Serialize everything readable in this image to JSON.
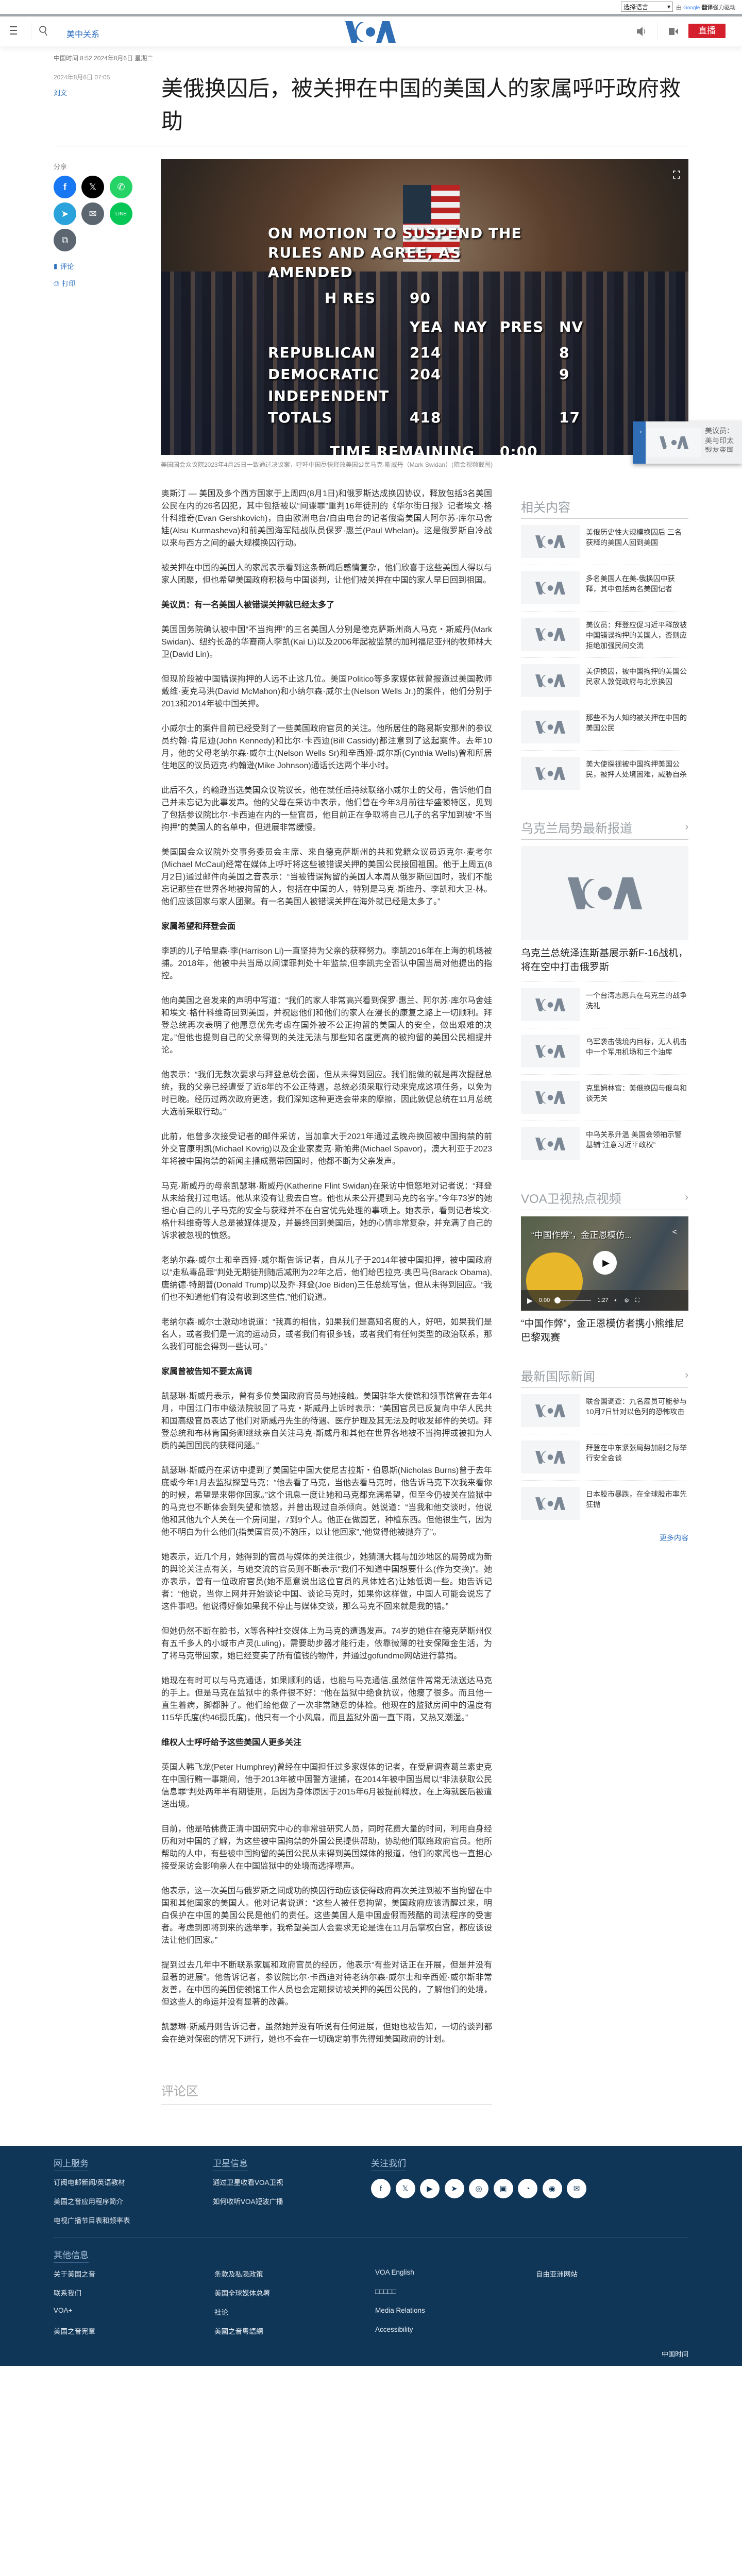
{
  "topbar": {
    "language_select": "选择语言",
    "translate_by": "由",
    "google": "Google",
    "translate": "翻译",
    "powered": "强力驱动"
  },
  "nav": {
    "section": "美中关系",
    "logo": "VOA",
    "live": "直播"
  },
  "meta": {
    "dateline": "中国时间 8:52 2024年8月6日 星期二",
    "published": "2024年8月6日 07:05",
    "author": "刘文"
  },
  "title": "美俄换囚后，被关押在中国的美国人的家属呼吁政府救助",
  "share": {
    "label": "分享",
    "comment": "评论",
    "print": "打印"
  },
  "hero": {
    "tally": {
      "motion": [
        "ON MOTION TO SUSPEND THE",
        "RULES AND AGREE, AS",
        "AMENDED"
      ],
      "bill": "H RES",
      "bill_no": "90",
      "cols": [
        "YEA",
        "NAY",
        "PRES",
        "NV"
      ],
      "rows": [
        {
          "label": "REPUBLICAN",
          "yea": "214",
          "nv": "8"
        },
        {
          "label": "DEMOCRATIC",
          "yea": "204",
          "nv": "9"
        },
        {
          "label": "INDEPENDENT",
          "yea": "",
          "nv": ""
        },
        {
          "label": "TOTALS",
          "yea": "418",
          "nv": "17"
        }
      ],
      "time": "TIME REMAINING",
      "clock": "0:00"
    },
    "caption": "美国国会众议院2023年4月25日一致通过决议案，呼吁中国尽快释放美国公民马克·斯威丹（Mark Swidan）(院会视频截图)"
  },
  "popup": {
    "text": "美议员：美与印太盟友变国际准则"
  },
  "article": [
    {
      "type": "p",
      "text": "奥斯汀 — 美国及多个西方国家于上周四(8月1日)和俄罗斯达成换囚协议，释放包括3名美国公民在内的26名囚犯，其中包括被以“间谍罪”重判16年徒刑的《华尔街日报》记者埃文·格什科维奇(Evan Gershkovich)，自由欧洲电台/自由电台的记者俄裔美国人阿尔苏·库尔马舍娃(Alsu Kurmasheva)和前美国海军陆战队员保罗·惠兰(Paul Whelan)。这是俄罗斯自冷战以来与西方之间的最大规模换囚行动。"
    },
    {
      "type": "p",
      "text": "被关押在中国的美国人的家属表示看到这条新闻后感情复杂，他们欣喜于这些美国人得以与家人团聚，但也希望美国政府积极与中国谈判，让他们被关押在中国的家人早日回到祖国。"
    },
    {
      "type": "h",
      "text": "美议员：有一名美国人被错误关押就已经太多了"
    },
    {
      "type": "p",
      "text": "美国国务院确认被中国“不当拘押”的三名美国人分别是德克萨斯州商人马克・斯威丹(Mark Swidan)、纽约长岛的华裔商人李凯(Kai Li)以及2006年起被监禁的加利福尼亚州的牧师林大卫(David Lin)。"
    },
    {
      "type": "p",
      "text": "但现阶段被中国错误拘押的人远不止这几位。美国Politico等多家媒体就曾报道过美国教师戴维·麦克马洪(David McMahon)和小纳尔森·威尔士(Nelson Wells Jr.)的案件，他们分别于2013和2014年被中国关押。"
    },
    {
      "type": "p",
      "text": "小威尔士的案件目前已经受到了一些美国政府官员的关注。他所居住的路易斯安那州的参议员约翰·肯尼迪(John Kennedy)和比尔·卡西迪(Bill Cassidy)都注意到了这起案件。去年10月，他的父母老纳尔森·威尔士(Nelson Wells Sr)和辛西娅·威尔斯(Cynthia Wells)曾和所居住地区的议员迈克·约翰逊(Mike Johnson)通话长达两个半小时。"
    },
    {
      "type": "p",
      "text": "此后不久，约翰逊当选美国众议院议长，他在就任后持续联络小威尔士的父母，告诉他们自己并未忘记为此事发声。他的父母在采访中表示，他们曾在今年3月前往华盛顿特区，见到了包括参议院比尔·卡西迪在内的一些官员，他目前正在争取将自己儿子的名字加到被“不当拘押”的美国人的名单中，但进展非常缓慢。"
    },
    {
      "type": "p",
      "text": "美国国会众议院外交事务委员会主席、来自德克萨斯州的共和党籍众议员迈克尔·麦考尔(Michael McCaul)经常在媒体上呼吁将这些被错误关押的美国公民接回祖国。他于上周五(8月2日)通过邮件向美国之音表示：“当被错误拘留的美国人本周从俄罗斯回国时，我们不能忘记那些在世界各地被拘留的人，包括在中国的人，特别是马克·斯维丹、李凯和大卫·林。他们应该回家与家人团聚。有一名美国人被错误关押在海外就已经是太多了。”"
    },
    {
      "type": "h",
      "text": "家属希望和拜登会面"
    },
    {
      "type": "p",
      "text": "李凯的儿子哈里森·李(Harrison Li)一直坚持为父亲的获释努力。李凯2016年在上海的机场被捕。2018年，他被中共当局以间谍罪判处十年监禁,但李凯完全否认中国当局对他提出的指控。"
    },
    {
      "type": "p",
      "text": "他向美国之音发来的声明中写道：“我们的家人非常高兴看到保罗·惠兰、阿尔苏·库尔马舍娃和埃文·格什科维奇回到美国，并祝愿他们和他们的家人在漫长的康复之路上一切顺利。拜登总统再次表明了他愿意优先考虑在国外被不公正拘留的美国人的安全，做出艰难的决定。”但他也提到自己的父亲得到的关注无法与那些知名度更高的被拘留的美国公民相提并论。"
    },
    {
      "type": "p",
      "text": "他表示：“我们无数次要求与拜登总统会面，但从未得到回应。我们能做的就是再次提醒总统，我的父亲已经遭受了近8年的不公正待遇，总统必须采取行动来完成这项任务，以免为时已晚。经历过两次政府更迭，我们深知这种更迭会带来的摩擦，因此敦促总统在11月总统大选前采取行动。”"
    },
    {
      "type": "p",
      "text": "此前，他曾多次接受记者的邮件采访，当加拿大于2021年通过孟晚舟换回被中国拘禁的前外交官康明凯(Michael Kovrig)以及企业家麦克·斯帕弗(Michael Spavor)，澳大利亚于2023年将被中国拘禁的新闻主播成蕾带回国时，他都不断为父亲发声。"
    },
    {
      "type": "p",
      "text": "马克·斯威丹的母亲凯瑟琳·斯威丹(Katherine Flint Swidan)在采访中愤怒地对记者说：“拜登从未给我打过电话。他从来没有让我去白宫。他也从未公开提到马克的名字。”今年73岁的她担心自己的儿子马克的安全与获释并不在白宫优先处理的事项上。她表示，看到记者埃文·格什科维奇等人总是被媒体提及，并最终回到美国后，她的心情非常复杂，并充满了自己的诉求被忽视的愤怒。"
    },
    {
      "type": "p",
      "text": "老纳尔森·威尔士和辛西娅·威尔斯告诉记者，自从儿子于2014年被中国扣押，被中国政府以“走私毒品罪”判处无期徒刑随后减刑为22年之后，他们给巴拉克·奥巴马(Barack Obama),唐纳德·特朗普(Donald Trump)以及乔·拜登(Joe Biden)三任总统写信，但从未得到回应。“我们也不知道他们有没有收到这些信,”他们说道。"
    },
    {
      "type": "p",
      "text": "老纳尔森·威尔士激动地说道：“我真的相信，如果我们是高知名度的人，好吧，如果我们是名人，或者我们是一流的运动员，或者我们有很多钱，或者我们有任何类型的政治联系，那么我们可能会得到一些认可。”"
    },
    {
      "type": "h",
      "text": "家属曾被告知不要太高调"
    },
    {
      "type": "p",
      "text": "凯瑟琳·斯威丹表示，曾有多位美国政府官员与她接触。美国驻华大使馆和领事馆曾在去年4月，中国江门市中级法院驳回了马克・斯威丹上诉时表示：“美国官员已反复向中华人民共和国高级官员表达了他们对斯威丹先生的待遇、医疗护理及其无法及时收发邮件的关切。拜登总统和布林肯国务卿继续亲自关注马克·斯威丹和其他在世界各地被不当拘押或被扣为人质的美国国民的获释问题。”"
    },
    {
      "type": "p",
      "text": "凯瑟琳·斯威丹在采访中提到了美国驻中国大使尼古拉斯・伯恩斯(Nicholas Burns)曾于去年底或今年1月去监狱探望马克：“他去看了马克，当他去看马克时，他告诉马克下次我来看你的时候，希望是来带你回家。”这个讯息一度让她和马克都充满希望，但至今仍被关在监狱中的马克也不断体会到失望和愤怒，并曾出现过自杀倾向。她说道：“当我和他交谈时，他说他和其他九个人关在一个房间里，7到9个人。他正在做园艺，种植东西。但他很生气，因为他不明白为什么他们(指美国官员)不施压，以让他回家”,“他觉得他被抛弃了”。"
    },
    {
      "type": "p",
      "text": "她表示，近几个月，她得到的官员与媒体的关注很少，她猜测大概与加沙地区的局势成为新的舆论关注点有关，与她交流的官员则不断表示“我们不知道中国想要什么(作为交换)”。她亦表示，曾有一位政府官员(她不愿意说出这位官员的具体姓名)让她低调一些。她告诉记者：“他说，当你上网并开始谈论中国、谈论马克时，如果你这样做，中国人可能会说忘了这件事吧。他说得好像如果我不停止与媒体交谈，那么马克不回来就是我的错。”"
    },
    {
      "type": "p",
      "text": "但她仍然不断在脸书，X等各种社交媒体上为马克的遭遇发声。74岁的她住在德克萨斯州仅有五千多人的小城市卢灵(Luling)，需要助步器才能行走，依靠微薄的社安保障金生活，为了将马克带回家，她已经变卖了所有值钱的物件，并通过gofundme网站进行募捐。"
    },
    {
      "type": "p",
      "text": "她现在有时可以与马克通话，如果顺利的话，也能与马克通信,虽然信件常常无法送达马克的手上。但是马克在监狱中的条件很不好：“他在监狱中绝食抗议，他瘦了很多。而且他一直生着病，脚都肿了。他们给他做了一次非常随意的体检。他现在的监狱房间中的温度有115华氏度(约46摄氏度)，他只有一个小风扇，而且监狱外面一直下雨，又热又潮湿。”"
    },
    {
      "type": "h",
      "text": "维权人士呼吁给予这些美国人更多关注"
    },
    {
      "type": "p",
      "text": "英国人韩飞龙(Peter Humphrey)曾经在中国担任过多家媒体的记者，在受雇调查葛兰素史克在中国行贿一事期间，他于2013年被中国警方逮捕，在2014年被中国当局以“非法获取公民信息罪”判处两年半有期徒刑，后因为身体原因于2015年6月被提前释放，在上海就医后被遣送出境。"
    },
    {
      "type": "p",
      "text": "目前，他是哈佛费正清中国研究中心的非常驻研究人员，同时花费大量的时间，利用自身经历和对中国的了解，为这些被中国拘禁的外国公民提供帮助，协助他们联络政府官员。他所帮助的人中，有些被中国拘留的美国公民从未得到美国媒体的报道，他们的家属也一直担心接受采访会影响亲人在中国监狱中的处境而选择噤声。"
    },
    {
      "type": "p",
      "text": "他表示，这一次美国与俄罗斯之间成功的换囚行动应该使得政府再次关注到被不当拘留在中国和其他国家的美国人。他对记者说道：“这些人被任意拘留，美国政府应该清醒过来，明白保护在中国的美国公民是他们的责任。这些美国人是中国虚假而残酷的司法程序的受害者。考虑到即将到来的选举季，我希望美国人会要求无论是谁在11月后掌权白宫，都应该设法让他们回家。”"
    },
    {
      "type": "p",
      "text": "提到过去几年中不断联系家属和政府官员的经历，他表示“有些对话正在开展，但是并没有显著的进展”。他告诉记者，参议院比尔·卡西迪对待老纳尔森·威尔士和辛西娅·威尔斯非常友善，在中国的美国使领馆工作人员也会定期探访被关押的美国公民的，了解他们的处境，但这些人的命运并没有显著的改善。"
    },
    {
      "type": "p",
      "text": "凯瑟琳·斯威丹则告诉记者，虽然她并没有听说有任何进展，但她也被告知，一切的谈判都会在绝对保密的情况下进行，她也不会在一切确定前事先得知美国政府的计划。"
    }
  ],
  "comments_heading": "评论区",
  "sidebar": {
    "related": {
      "heading": "相关内容",
      "items": [
        "美俄历史性大规模换囚后 三名获释的美国人回到美国",
        "多名美国人在美-俄换囚中获释，其中包括两名美国记者",
        "美议员：拜登应促习近平释放被中国错误拘押的美国人，否则应拒绝加强民间交流",
        "美伊换囚，被中国拘押的美国公民家人敦促政府与北京换囚",
        "那些不为人知的被关押在中国的美国公民",
        "美大使探视被中国拘押美国公民，被押人处境困难，威胁自杀"
      ]
    },
    "ukraine": {
      "heading": "乌克兰局势最新报道",
      "lead": "乌克兰总统泽连斯基展示新F-16战机，将在空中打击俄罗斯",
      "items": [
        "一个台湾志愿兵在乌克兰的战争洗礼",
        "乌军袭击俄境内目标，无人机击中一个军用机场和三个油库",
        "克里姆林宫：美俄换囚与俄乌和谈无关",
        "中乌关系升温 美国会领袖示警基辅“注意习近平政权”"
      ]
    },
    "video": {
      "heading": "VOA卫视热点视频",
      "overlay_title": "“中国作弊”，金正恩模仿...",
      "current": "0:00",
      "duration": "1:27",
      "title": "“中国作弊”，金正恩模仿者携小熊维尼巴黎观赛"
    },
    "intl": {
      "heading": "最新国际新闻",
      "items": [
        "联合国调查：九名雇员可能参与10月7日针对以色列的恐怖攻击",
        "拜登在中东紧张局势加剧之际举行安全会谈",
        "日本股市暴跌，在全球股市率先狂抛"
      ],
      "more": "更多内容"
    }
  },
  "footer": {
    "online": {
      "heading": "网上服务",
      "links": [
        "订阅电邮新闻/英语教材",
        "美国之音应用程序简介",
        "电视广播节目表和频率表"
      ]
    },
    "satellite": {
      "heading": "卫星信息",
      "links": [
        "通过卫星收看VOA卫视",
        "如何收听VOA短波广播"
      ]
    },
    "follow": {
      "heading": "关注我们",
      "icons": [
        "facebook-icon",
        "x-icon",
        "youtube-icon",
        "telegram-icon",
        "instagram-icon",
        "app-icon",
        "rss-icon",
        "podcast-icon",
        "email-icon"
      ]
    },
    "other": {
      "heading": "其他信息",
      "cols": [
        [
          "关于美国之音",
          "联系我们",
          "VOA+",
          "美国之音宪章"
        ],
        [
          "条款及私隐政策",
          "美国全球媒体总署",
          "社论",
          "美國之音粵語網"
        ],
        [
          "VOA English",
          "□□□□□",
          "Media Relations",
          "Accessibility"
        ],
        [
          "自由亚洲网站"
        ]
      ]
    },
    "timezone": "中国时间"
  },
  "colors": {
    "brand_blue": "#2f6db5",
    "live_red": "#d4202c",
    "footer_bg": "#0f3557"
  }
}
